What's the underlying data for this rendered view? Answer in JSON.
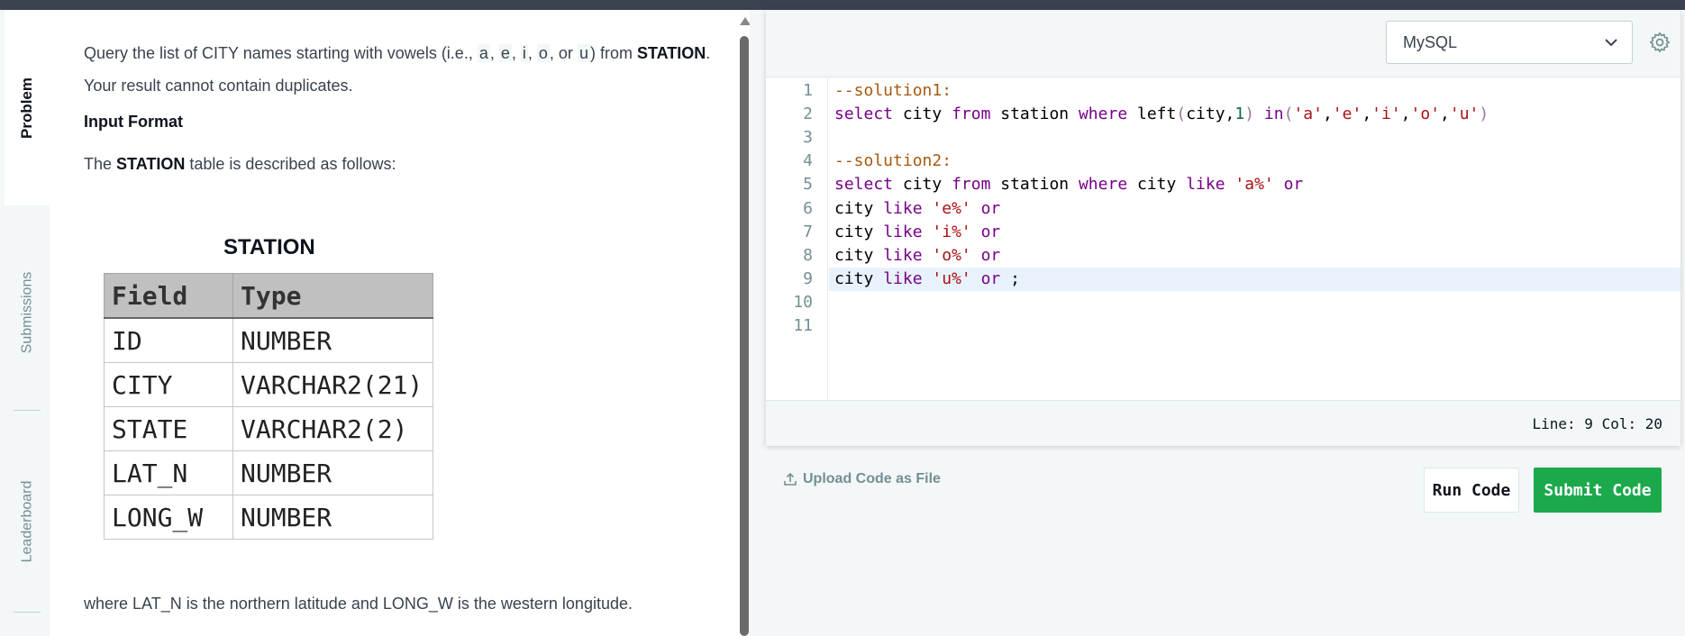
{
  "tabs": [
    {
      "label": "Problem",
      "active": true
    },
    {
      "label": "Submissions",
      "active": false
    },
    {
      "label": "Leaderboard",
      "active": false
    }
  ],
  "problem": {
    "intro_prefix": "Query the list of CITY names starting with vowels (i.e., ",
    "vowels": [
      "a",
      "e",
      "i",
      "o",
      "u"
    ],
    "intro_sep": ", ",
    "intro_or": ", or ",
    "intro_mid": ") from ",
    "intro_table": "STATION",
    "intro_end": ".",
    "no_dupes": "Your result cannot contain duplicates.",
    "input_heading": "Input Format",
    "described_prefix": "The ",
    "described_table": "STATION",
    "described_suffix": " table is described as follows:",
    "table_title": "STATION",
    "table_headers": [
      "Field",
      "Type"
    ],
    "table_rows": [
      [
        "ID",
        "NUMBER"
      ],
      [
        "CITY",
        "VARCHAR2(21)"
      ],
      [
        "STATE",
        "VARCHAR2(2)"
      ],
      [
        "LAT_N",
        "NUMBER"
      ],
      [
        "LONG_W",
        "NUMBER"
      ]
    ],
    "footer": "where LAT_N is the northern latitude and LONG_W is the western longitude."
  },
  "editor": {
    "language": "MySQL",
    "icons": {
      "dropdown": "chevron-down-icon",
      "settings": "gear-icon",
      "upload": "upload-icon"
    },
    "lines": [
      {
        "n": "1",
        "text": "--solution1:"
      },
      {
        "n": "2",
        "text": "select city from station where left(city,1) in('a','e','i','o','u')"
      },
      {
        "n": "3",
        "text": ""
      },
      {
        "n": "4",
        "text": "--solution2:"
      },
      {
        "n": "5",
        "text": "select city from station where city like 'a%' or"
      },
      {
        "n": "6",
        "text": "city like 'e%' or"
      },
      {
        "n": "7",
        "text": "city like 'i%' or"
      },
      {
        "n": "8",
        "text": "city like 'o%' or"
      },
      {
        "n": "9",
        "text": "city like 'u%' or ;"
      },
      {
        "n": "10",
        "text": ""
      },
      {
        "n": "11",
        "text": ""
      }
    ],
    "current_line": 9,
    "cursor_status": "Line: 9 Col: 20"
  },
  "actions": {
    "upload_label": "Upload Code as File",
    "run_label": "Run Code",
    "submit_label": "Submit Code"
  },
  "colors": {
    "submit_bg": "#1ba94c",
    "topbar": "#39424e",
    "panel_bg": "#f3f7f7"
  }
}
